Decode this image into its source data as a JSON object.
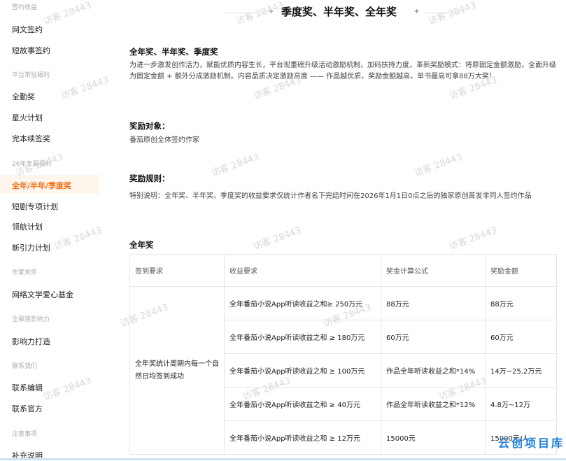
{
  "sidebar": {
    "groups": [
      {
        "title": "签约收益",
        "items": [
          "网文签约",
          "短故事签约"
        ]
      },
      {
        "title": "平台常驻福利",
        "items": [
          "全勤奖",
          "星火计划",
          "完本续签奖"
        ]
      },
      {
        "title": "26年专属福利",
        "items": [
          "全年/半年/季度奖",
          "短剧专项计划",
          "领航计划",
          "新引力计划"
        ]
      },
      {
        "title": "作家关怀",
        "items": [
          "网络文学爱心基金"
        ]
      },
      {
        "title": "全渠道影响力",
        "items": [
          "影响力打造"
        ]
      },
      {
        "title": "联系我们",
        "items": [
          "联系编辑",
          "联系官方"
        ]
      },
      {
        "title": "注意事项",
        "items": [
          "补充说明"
        ]
      }
    ],
    "active": "全年/半年/季度奖"
  },
  "main": {
    "page_title": "季度奖、半年奖、全年奖",
    "section1_title": "全年奖、半年奖、季度奖",
    "section1_text": "为进一步激发创作活力，赋能优质内容生长，平台现重磅升级活动激励机制，加码扶持力度，革新奖励模式：将原固定金额激励，全面升级为固定金额 + 额外分成激励机制。内容品质决定激励高度 —— 作品越优质，奖励金额越高，单书最高可拿88万大奖！",
    "target_title": "奖励对象：",
    "target_text": "番茄原创全体签约作家",
    "rules_title": "奖励规则：",
    "rules_text": "特别说明：全年奖、半年奖、季度奖的收益要求仅统计作者名下完结时间在2026年1月1日0点之后的独家原创首发非同人签约作品",
    "annual_title": "全年奖",
    "table": {
      "headers": [
        "签到要求",
        "收益要求",
        "奖金计算公式",
        "奖励金额"
      ],
      "sign_req": "全年奖统计周期内每一个自然日均签到成功",
      "rows": [
        {
          "income": "全年番茄小说App听读收益之和≥ 250万元",
          "formula": "88万元",
          "amount": "88万元"
        },
        {
          "income": "全年番茄小说App听读收益之和 ≥ 180万元",
          "formula": "60万元",
          "amount": "60万元"
        },
        {
          "income": "全年番茄小说App听读收益之和 ≥ 100万元",
          "formula": "作品全年听读收益之和*14%",
          "amount": "14万~25.2万元"
        },
        {
          "income": "全年番茄小说App听读收益之和 ≥ 40万元",
          "formula": "作品全年听读收益之和*12%",
          "amount": "4.8万~12万"
        },
        {
          "income": "全年番茄小说App听读收益之和 ≥ 12万元",
          "formula": "15000元",
          "amount": "15000元/人"
        }
      ]
    }
  },
  "watermark_text": "访客 28443",
  "brand_text": "云创项目库"
}
